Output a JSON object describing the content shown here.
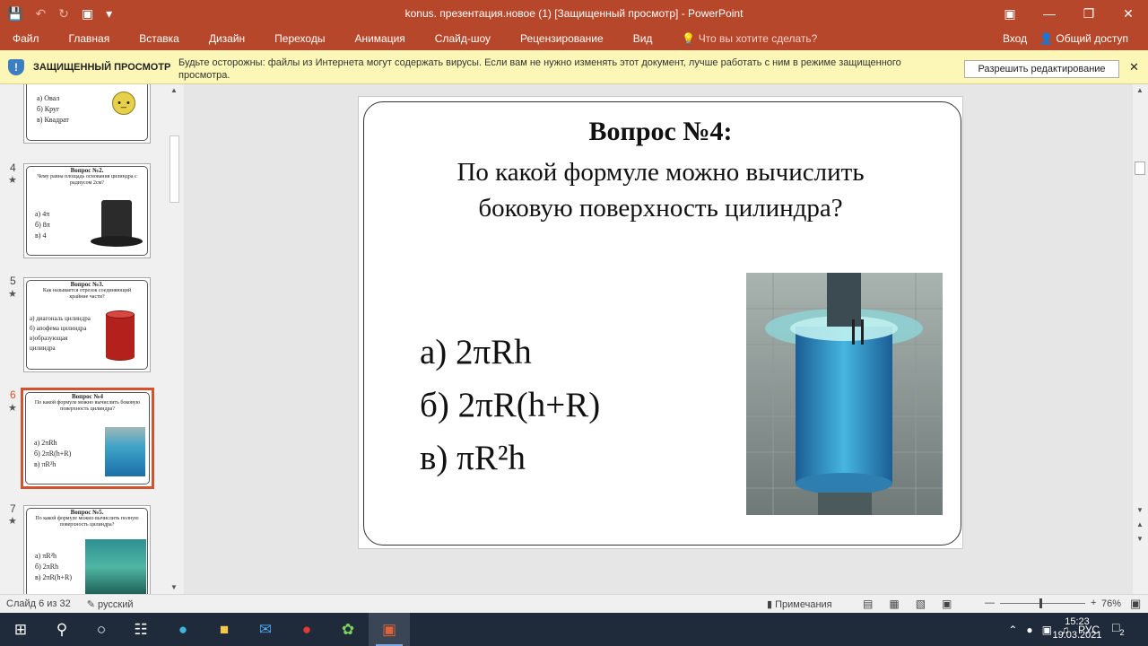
{
  "app": {
    "title": "konus. презентация.новое (1) [Защищенный просмотр] - PowerPoint",
    "qat": {
      "save_icon": "save-icon",
      "undo_icon": "undo-icon",
      "redo_icon": "redo-icon",
      "present_icon": "present-icon"
    }
  },
  "menu": {
    "tabs": [
      "Файл",
      "Главная",
      "Вставка",
      "Дизайн",
      "Переходы",
      "Анимация",
      "Слайд-шоу",
      "Рецензирование",
      "Вид"
    ],
    "tell_me": "Что вы хотите сделать?",
    "signin": "Вход",
    "share": "Общий доступ"
  },
  "protected_view": {
    "label": "ЗАЩИЩЕННЫЙ ПРОСМОТР",
    "message": "Будьте осторожны: файлы из Интернета могут содержать вирусы. Если вам не нужно изменять этот документ, лучше работать с ним в режиме защищенного просмотра.",
    "enable_button": "Разрешить редактирование"
  },
  "thumbnails": [
    {
      "num": "",
      "title": "",
      "subtitle": "",
      "options": [
        "а) Овал",
        "б) Круг",
        "в) Квадрат"
      ]
    },
    {
      "num": "4",
      "title": "Вопрос №2.",
      "subtitle": "Чему равна площадь основания цилиндра с радиусом 2см?",
      "options": [
        "а) 4π",
        "б) 8π",
        "в) 4"
      ]
    },
    {
      "num": "5",
      "title": "Вопрос №3.",
      "subtitle": "Как называется отрезок соединяющий крайние части?",
      "options": [
        "а) диагональ цилиндра",
        "б) апофема цилиндра",
        "в)образующая",
        "   цилиндра"
      ]
    },
    {
      "num": "6",
      "title": "Вопрос №4",
      "subtitle": "По какой формуле можно вычислить боковую поверхность цилиндра?",
      "options": [
        "а) 2πRh",
        "б) 2πR(h+R)",
        "в) πR²h"
      ]
    },
    {
      "num": "7",
      "title": "Вопрос №5.",
      "subtitle": "По какой формуле можно вычислить полную поверхность цилиндра?",
      "options": [
        "а) πR²h",
        "б) 2πRh",
        "в) 2πR(h+R)"
      ]
    }
  ],
  "slide": {
    "title": "Вопрос №4:",
    "question": "По какой формуле можно вычислить боковую поверхность цилиндра?",
    "answers": [
      "а) 2πRh",
      "б) 2πR(h+R)",
      "в) πR²h"
    ]
  },
  "status": {
    "slide_info": "Слайд 6 из 32",
    "language": "русский",
    "notes": "Примечания",
    "zoom": "76%"
  },
  "taskbar": {
    "lang": "РУС",
    "time": "15:23",
    "date": "19.03.2021",
    "notifications": "2"
  }
}
